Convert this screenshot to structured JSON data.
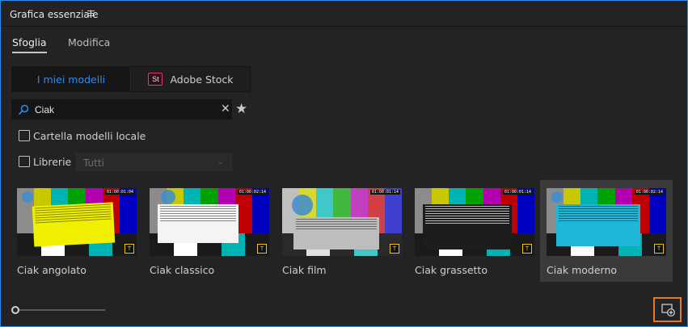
{
  "panel": {
    "title": "Grafica essenziale"
  },
  "tabs": [
    {
      "label": "Sfoglia"
    },
    {
      "label": "Modifica"
    }
  ],
  "source": {
    "mine": "I miei modelli",
    "stock": "Adobe Stock",
    "stock_logo": "St"
  },
  "search": {
    "value": "Ciak"
  },
  "filters": {
    "local": "Cartella modelli locale",
    "libraries": "Librerie",
    "libraries_select": "Tutti"
  },
  "templates": [
    {
      "label": "Ciak angolato",
      "tc": "01:00:01:04"
    },
    {
      "label": "Ciak classico",
      "tc": "01:00:02:14"
    },
    {
      "label": "Ciak film",
      "tc": "01:00:01:14"
    },
    {
      "label": "Ciak grassetto",
      "tc": "01:00:01:14"
    },
    {
      "label": "Ciak moderno",
      "tc": "01:00:02:14"
    }
  ],
  "colors": {
    "accent": "#2d8ceb",
    "highlight": "#e47a26",
    "stock": "#e0387a"
  }
}
